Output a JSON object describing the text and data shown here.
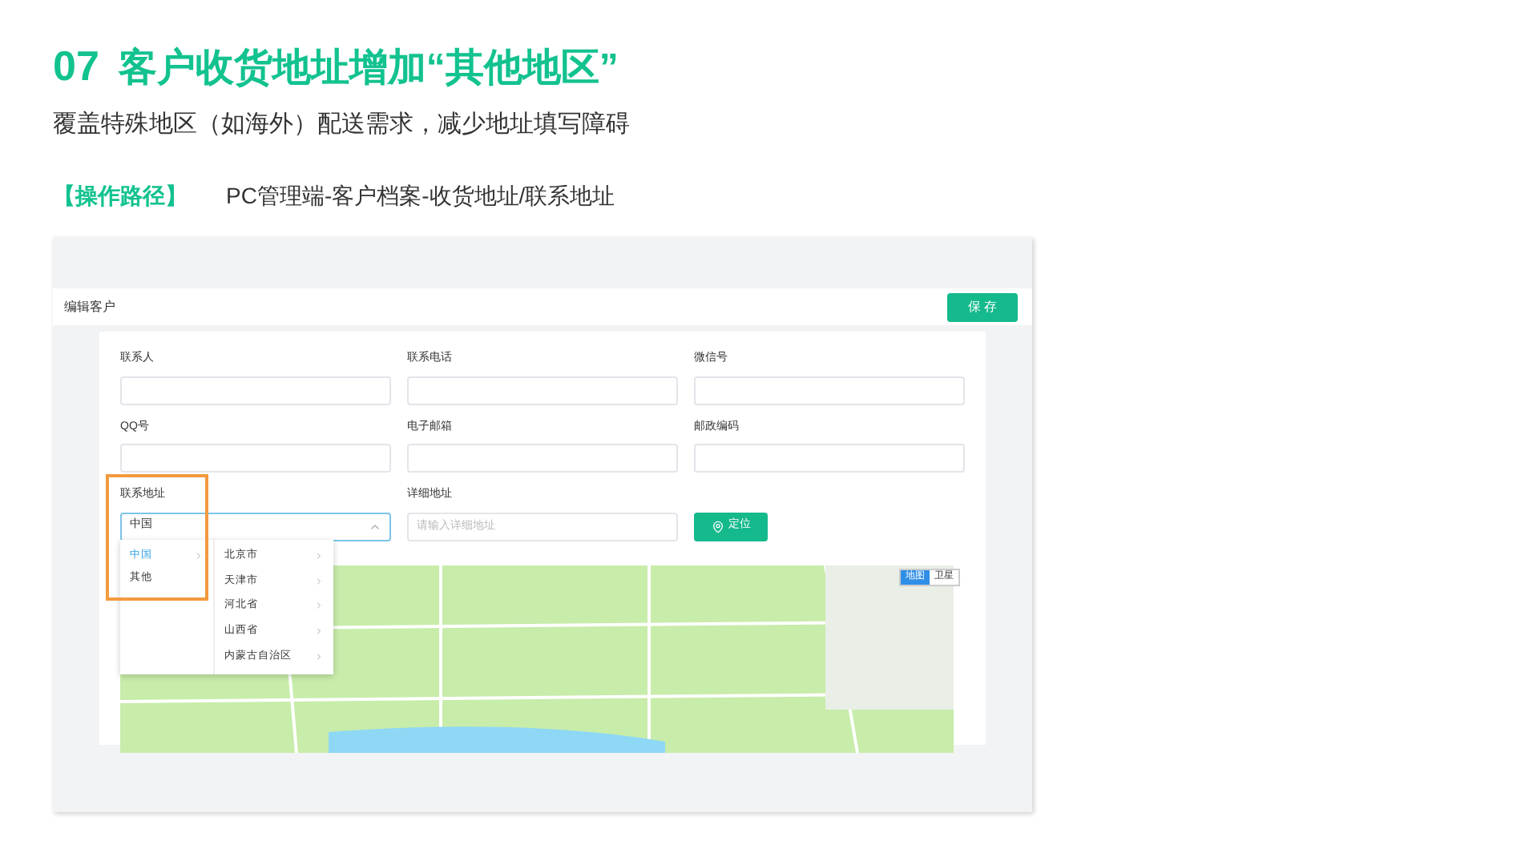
{
  "heading": {
    "number": "07",
    "title": "客户收货地址增加“其他地区”"
  },
  "subtitle": "覆盖特殊地区（如海外）配送需求，减少地址填写障碍",
  "path": {
    "label": "【操作路径】",
    "value": "PC管理端-客户档案-收货地址/联系地址"
  },
  "screen": {
    "page_title": "编辑客户",
    "save_button": "保 存",
    "fields": [
      {
        "label": "联系人"
      },
      {
        "label": "联系电话"
      },
      {
        "label": "微信号"
      },
      {
        "label": "QQ号"
      },
      {
        "label": "电子邮箱"
      },
      {
        "label": "邮政编码"
      }
    ],
    "address": {
      "label": "联系地址",
      "value": "中国",
      "expanded": true
    },
    "detail": {
      "label": "详细地址",
      "placeholder": "请输入详细地址"
    },
    "locate_button": "定位",
    "cascader": {
      "countries": [
        {
          "label": "中国",
          "selected": true
        },
        {
          "label": "其他",
          "selected": false
        }
      ],
      "regions": [
        {
          "label": "北京市"
        },
        {
          "label": "天津市"
        },
        {
          "label": "河北省"
        },
        {
          "label": "山西省"
        },
        {
          "label": "内蒙古自治区"
        }
      ]
    },
    "map_types": [
      {
        "label": "地图",
        "selected": true
      },
      {
        "label": "卫星",
        "selected": false
      }
    ]
  }
}
